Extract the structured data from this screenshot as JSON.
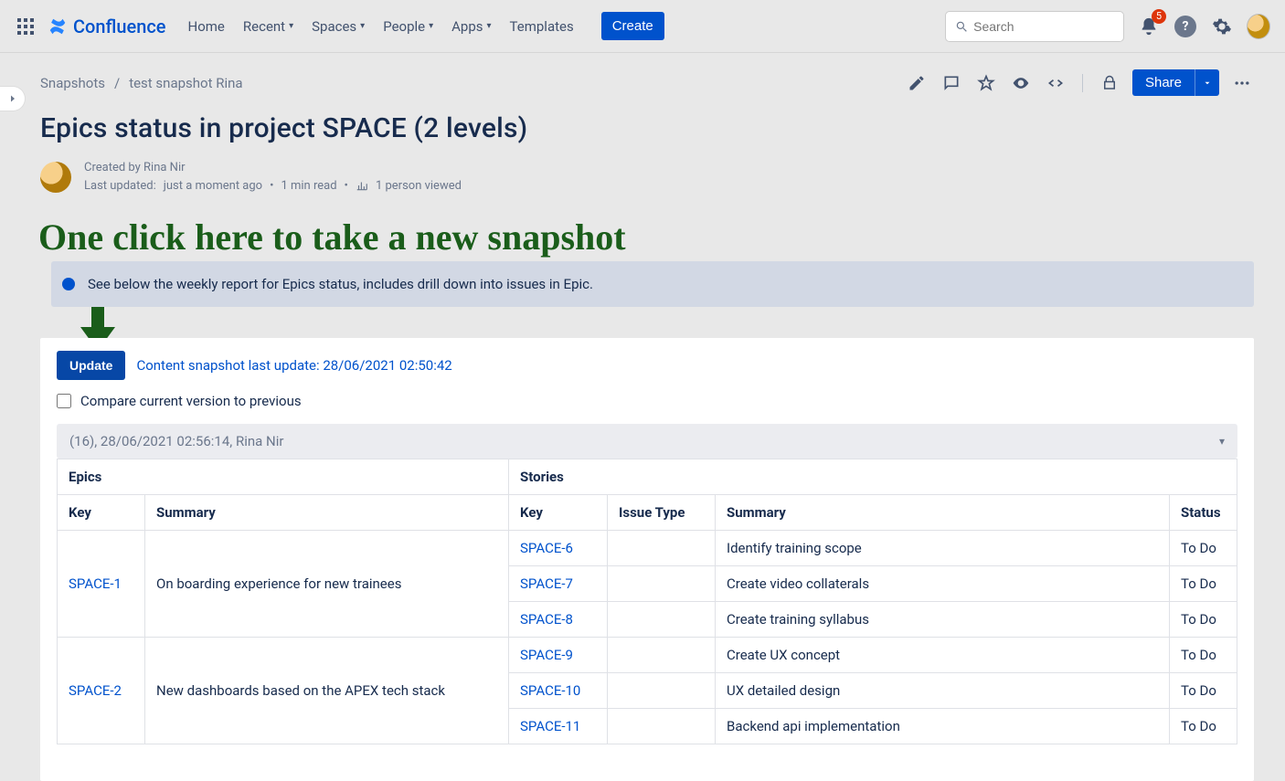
{
  "topbar": {
    "product": "Confluence",
    "nav": {
      "home": "Home",
      "recent": "Recent",
      "spaces": "Spaces",
      "people": "People",
      "apps": "Apps",
      "templates": "Templates",
      "create": "Create"
    },
    "search_placeholder": "Search",
    "notification_count": "5"
  },
  "breadcrumb": {
    "space": "Snapshots",
    "page": "test snapshot Rina"
  },
  "page_actions": {
    "share": "Share"
  },
  "title": "Epics status in project SPACE (2 levels)",
  "byline": {
    "created_by_label": "Created by",
    "author": "Rina Nir",
    "last_updated_label": "Last updated:",
    "last_updated_value": "just a moment ago",
    "read_time": "1 min read",
    "viewers": "1 person viewed"
  },
  "annotation": "One click here to take a new snapshot",
  "info_panel": "See below the weekly report for Epics status, includes drill down into issues in Epic.",
  "snapshot": {
    "update_btn": "Update",
    "last_update_text": "Content snapshot last update: 28/06/2021 02:50:42",
    "compare_label": "Compare current version to previous",
    "version_text": "(16), 28/06/2021 02:56:14, Rina Nir"
  },
  "table": {
    "groups": {
      "epics": "Epics",
      "stories": "Stories"
    },
    "cols": {
      "epic_key": "Key",
      "epic_summary": "Summary",
      "story_key": "Key",
      "issue_type": "Issue Type",
      "story_summary": "Summary",
      "status": "Status"
    },
    "epics": [
      {
        "key": "SPACE-1",
        "summary": "On boarding experience for new trainees",
        "stories": [
          {
            "key": "SPACE-6",
            "issue_type": "",
            "summary": "Identify training scope",
            "status": "To Do"
          },
          {
            "key": "SPACE-7",
            "issue_type": "",
            "summary": "Create video collaterals",
            "status": "To Do"
          },
          {
            "key": "SPACE-8",
            "issue_type": "",
            "summary": "Create training syllabus",
            "status": "To Do"
          }
        ]
      },
      {
        "key": "SPACE-2",
        "summary": "New dashboards based on the APEX tech stack",
        "stories": [
          {
            "key": "SPACE-9",
            "issue_type": "",
            "summary": "Create UX concept",
            "status": "To Do"
          },
          {
            "key": "SPACE-10",
            "issue_type": "",
            "summary": "UX detailed design",
            "status": "To Do"
          },
          {
            "key": "SPACE-11",
            "issue_type": "",
            "summary": "Backend api implementation",
            "status": "To Do"
          }
        ]
      }
    ]
  }
}
